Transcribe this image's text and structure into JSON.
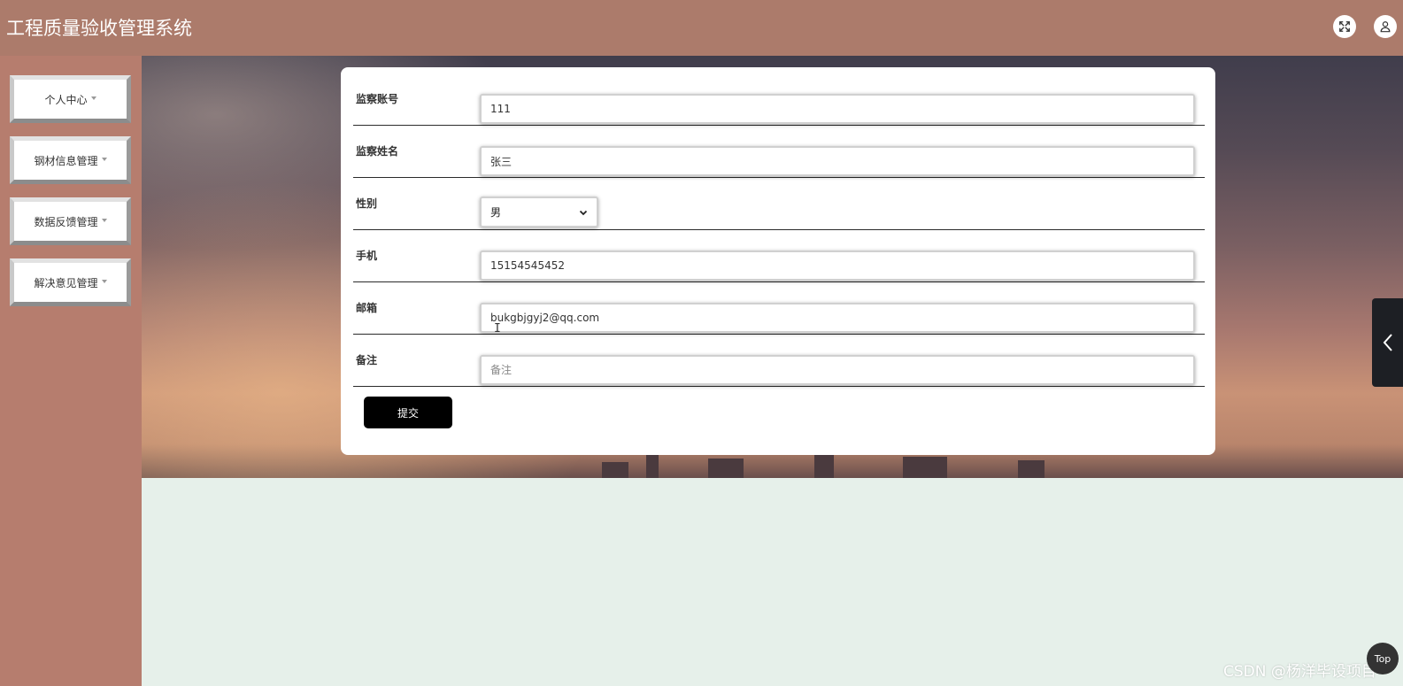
{
  "app": {
    "title": "工程质量验收管理系统"
  },
  "header": {
    "fullscreen_icon": "expand-icon",
    "user_icon": "user-icon"
  },
  "sidebar": {
    "items": [
      {
        "label": "个人中心"
      },
      {
        "label": "钢材信息管理"
      },
      {
        "label": "数据反馈管理"
      },
      {
        "label": "解决意见管理"
      }
    ]
  },
  "form": {
    "fields": [
      {
        "label": "监察账号",
        "value": "111",
        "placeholder": ""
      },
      {
        "label": "监察姓名",
        "value": "张三",
        "placeholder": ""
      },
      {
        "label": "性别",
        "value": "男"
      },
      {
        "label": "手机",
        "value": "15154545452",
        "placeholder": ""
      },
      {
        "label": "邮箱",
        "value": "bukgbjgyj2@qq.com",
        "placeholder": ""
      },
      {
        "label": "备注",
        "value": "",
        "placeholder": "备注"
      }
    ],
    "submit_label": "提交"
  },
  "side_tab": {
    "icon": "chevron-left-icon"
  },
  "footer": {
    "watermark": "CSDN @杨洋毕设项目",
    "top_label": "Top"
  },
  "colors": {
    "header_bg": "#ac7b6b",
    "sidebar_bg": "#b67d6e",
    "content_bg": "#e6f0ea",
    "button_bg": "#000000"
  }
}
